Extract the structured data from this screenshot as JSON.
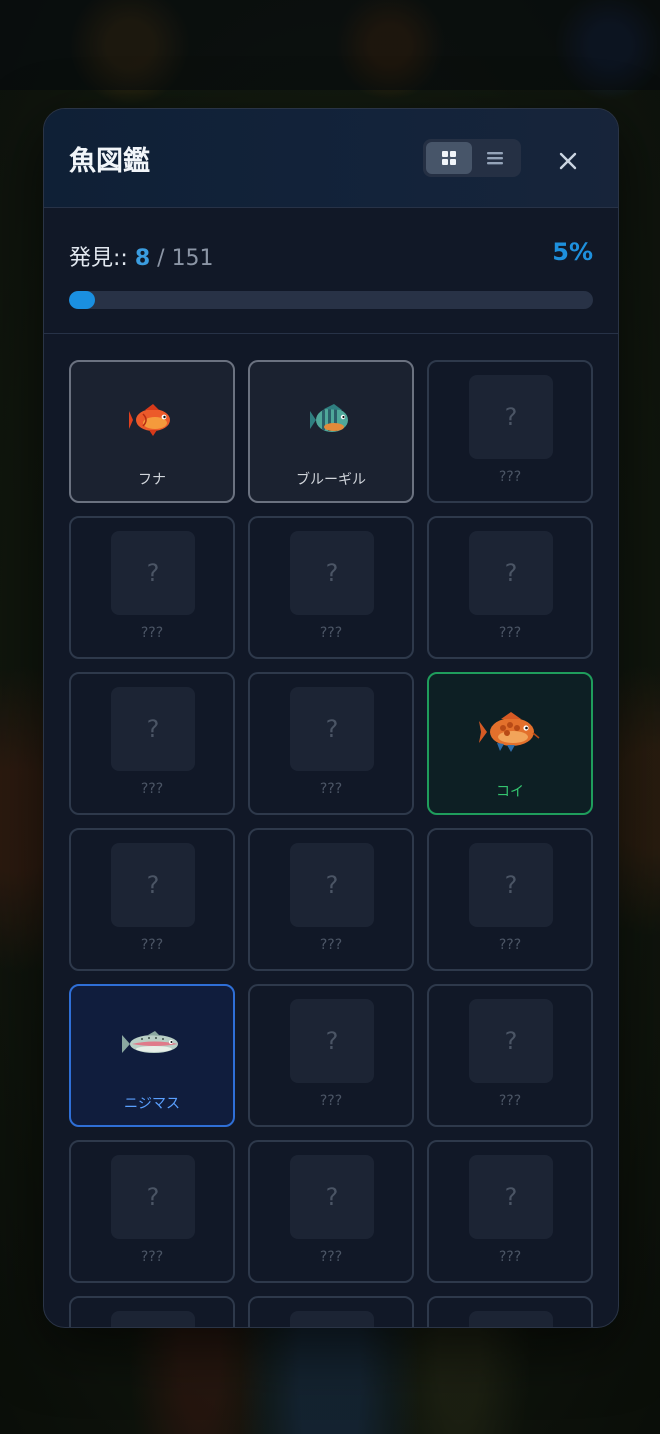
{
  "dialog": {
    "title": "魚図鑑",
    "view_toggle": {
      "grid_icon": "grid-icon",
      "list_icon": "list-icon",
      "active": "grid"
    },
    "close_icon": "close-icon"
  },
  "progress": {
    "label": "発見::",
    "found": "8",
    "separator": "/",
    "total": "151",
    "percent_label": "5%",
    "fraction": 0.05
  },
  "cards": [
    {
      "name": "フナ",
      "state": "found-std",
      "icon": "crucian-carp-icon"
    },
    {
      "name": "ブルーギル",
      "state": "found-std",
      "icon": "bluegill-icon"
    },
    {
      "name": "???",
      "state": "unknown",
      "placeholder": "?"
    },
    {
      "name": "???",
      "state": "unknown",
      "placeholder": "?"
    },
    {
      "name": "???",
      "state": "unknown",
      "placeholder": "?"
    },
    {
      "name": "???",
      "state": "unknown",
      "placeholder": "?"
    },
    {
      "name": "???",
      "state": "unknown",
      "placeholder": "?"
    },
    {
      "name": "???",
      "state": "unknown",
      "placeholder": "?"
    },
    {
      "name": "コイ",
      "state": "found-green",
      "icon": "koi-icon"
    },
    {
      "name": "???",
      "state": "unknown",
      "placeholder": "?"
    },
    {
      "name": "???",
      "state": "unknown",
      "placeholder": "?"
    },
    {
      "name": "???",
      "state": "unknown",
      "placeholder": "?"
    },
    {
      "name": "ニジマス",
      "state": "found-blue",
      "icon": "rainbow-trout-icon"
    },
    {
      "name": "???",
      "state": "unknown",
      "placeholder": "?"
    },
    {
      "name": "???",
      "state": "unknown",
      "placeholder": "?"
    },
    {
      "name": "???",
      "state": "unknown",
      "placeholder": "?"
    },
    {
      "name": "???",
      "state": "unknown",
      "placeholder": "?"
    },
    {
      "name": "???",
      "state": "unknown",
      "placeholder": "?"
    },
    {
      "name": "???",
      "state": "unknown",
      "placeholder": "?"
    },
    {
      "name": "???",
      "state": "unknown",
      "placeholder": "?"
    },
    {
      "name": "???",
      "state": "unknown",
      "placeholder": "?"
    }
  ],
  "colors": {
    "accent": "#1a8fe0",
    "common_border": "#6b7280",
    "uncommon_border": "#1f9d5c",
    "rare_border": "#2f6fd6"
  }
}
